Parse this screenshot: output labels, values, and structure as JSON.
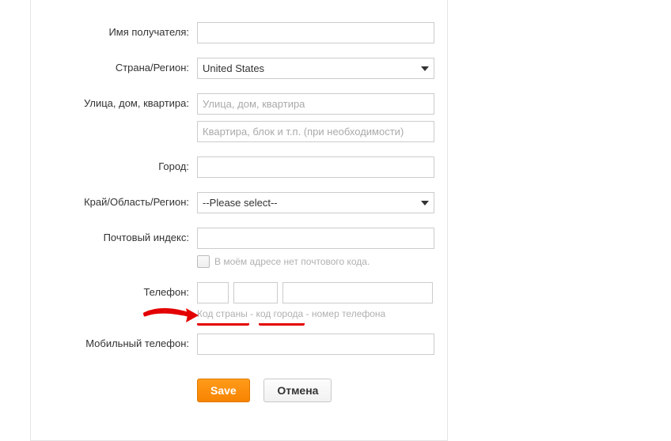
{
  "labels": {
    "recipient": "Имя получателя:",
    "country": "Страна/Регион:",
    "street": "Улица, дом, квартира:",
    "city": "Город:",
    "region": "Край/Область/Регион:",
    "postal": "Почтовый индекс:",
    "phone": "Телефон:",
    "mobile": "Мобильный телефон:"
  },
  "fields": {
    "recipient": "",
    "country_selected": "United States",
    "street_ph": "Улица, дом, квартира",
    "apt_ph": "Квартира, блок и т.п. (при необходимости)",
    "city": "",
    "region_selected": "--Please select--",
    "postal": "",
    "no_postal_checkbox_label": "В моём адресе нет почтового кода.",
    "phone_country": "",
    "phone_city": "",
    "phone_number": "",
    "phone_hint": "Код страны - код города - номер телефона",
    "mobile": ""
  },
  "buttons": {
    "save": "Save",
    "cancel": "Отмена"
  }
}
